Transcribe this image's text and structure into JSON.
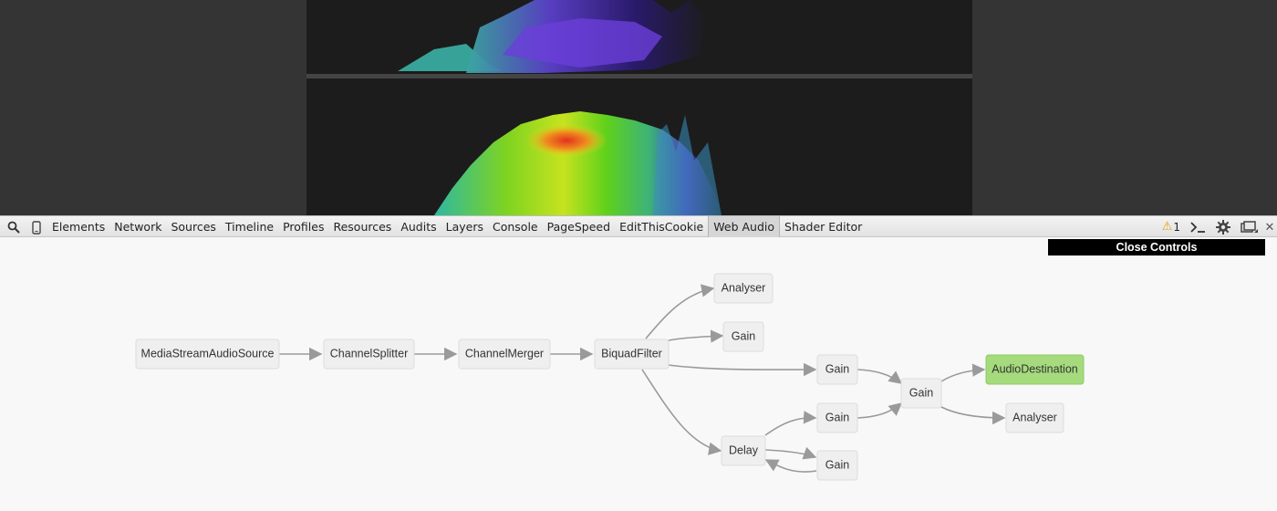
{
  "toolbar": {
    "tabs": [
      "Elements",
      "Network",
      "Sources",
      "Timeline",
      "Profiles",
      "Resources",
      "Audits",
      "Layers",
      "Console",
      "PageSpeed",
      "EditThisCookie",
      "Web Audio",
      "Shader Editor"
    ],
    "active_tab": "Web Audio",
    "warning_count": "1",
    "icons": [
      "search-icon",
      "device-mode-icon",
      "console-drawer-icon",
      "settings-gear-icon",
      "dock-side-icon",
      "close-icon"
    ]
  },
  "panel": {
    "close_controls_label": "Close Controls"
  },
  "graph": {
    "nodes": {
      "source": "MediaStreamAudioSource",
      "splitter": "ChannelSplitter",
      "merger": "ChannelMerger",
      "biquad": "BiquadFilter",
      "analyser1": "Analyser",
      "gain1": "Gain",
      "gain2": "Gain",
      "gain3": "Gain",
      "gain4": "Gain",
      "gain5": "Gain",
      "delay": "Delay",
      "destination": "AudioDestination",
      "analyser2": "Analyser"
    },
    "colors": {
      "node_fill": "#efefef",
      "destination_fill": "#a5db7d",
      "edge": "#9a9a9a"
    }
  }
}
